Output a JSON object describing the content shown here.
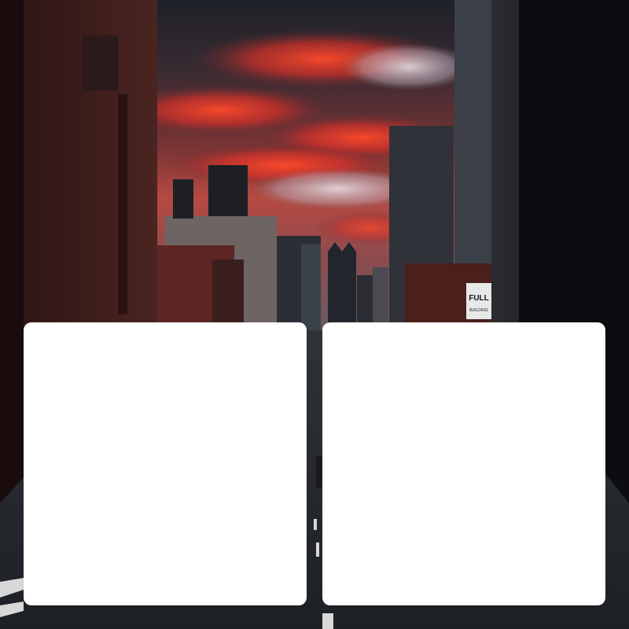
{
  "background": {
    "scene": "city-street-sunset",
    "colors": {
      "sky_dark": "#2a2d36",
      "sky_red": "#e0332b",
      "sky_orange": "#f27a3c",
      "sky_light": "#d7d1d6",
      "building_dark": "#14161a",
      "building_brick": "#5a2a24",
      "road": "#2c2f33"
    }
  },
  "cards": [
    {
      "id": "left",
      "color": "#ffffff"
    },
    {
      "id": "right",
      "color": "#ffffff"
    }
  ],
  "sign": {
    "line1": "FULL",
    "line2": "BUILDING"
  }
}
